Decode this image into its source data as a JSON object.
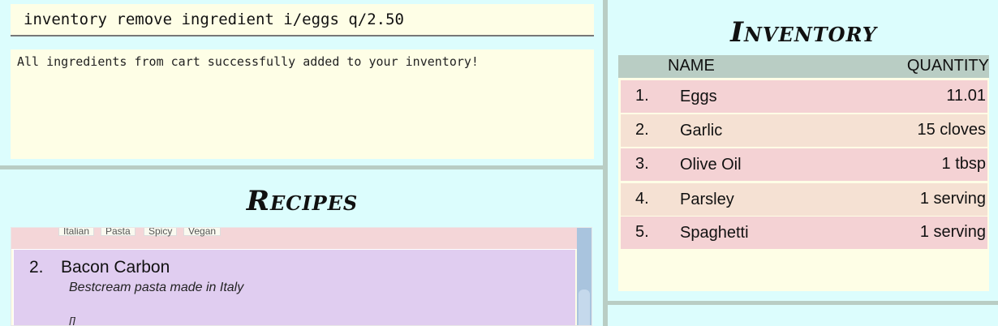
{
  "command": {
    "text": "inventory remove ingredient i/eggs q/2.50"
  },
  "result": {
    "text": "All ingredients from cart successfully added to your inventory!"
  },
  "recipes": {
    "title": "Recipes",
    "previous_card_tags": [
      "Italian",
      "Pasta",
      "Spicy",
      "Vegan"
    ],
    "current": {
      "index": "2.",
      "name": "Bacon Carbon",
      "description": "Bestcream pasta made in Italy",
      "tags": "[]"
    }
  },
  "inventory": {
    "title": "Inventory",
    "headers": {
      "name": "NAME",
      "quantity": "QUANTITY"
    },
    "rows": [
      {
        "index": "1.",
        "name": "Eggs",
        "quantity": "11.01"
      },
      {
        "index": "2.",
        "name": "Garlic",
        "quantity": "15 cloves"
      },
      {
        "index": "3.",
        "name": "Olive Oil",
        "quantity": "1 tbsp"
      },
      {
        "index": "4.",
        "name": "Parsley",
        "quantity": "1 serving"
      },
      {
        "index": "5.",
        "name": "Spaghetti",
        "quantity": "1 serving"
      }
    ]
  },
  "colors": {
    "background": "#dcfdfd",
    "panel": "#fefee6",
    "divider": "#b9cdc4",
    "row_pink": "#f4d2d4",
    "row_peach": "#f5e1d3",
    "recipe_card": "#e0cdf0",
    "scrollbar": "#a9c4de"
  }
}
